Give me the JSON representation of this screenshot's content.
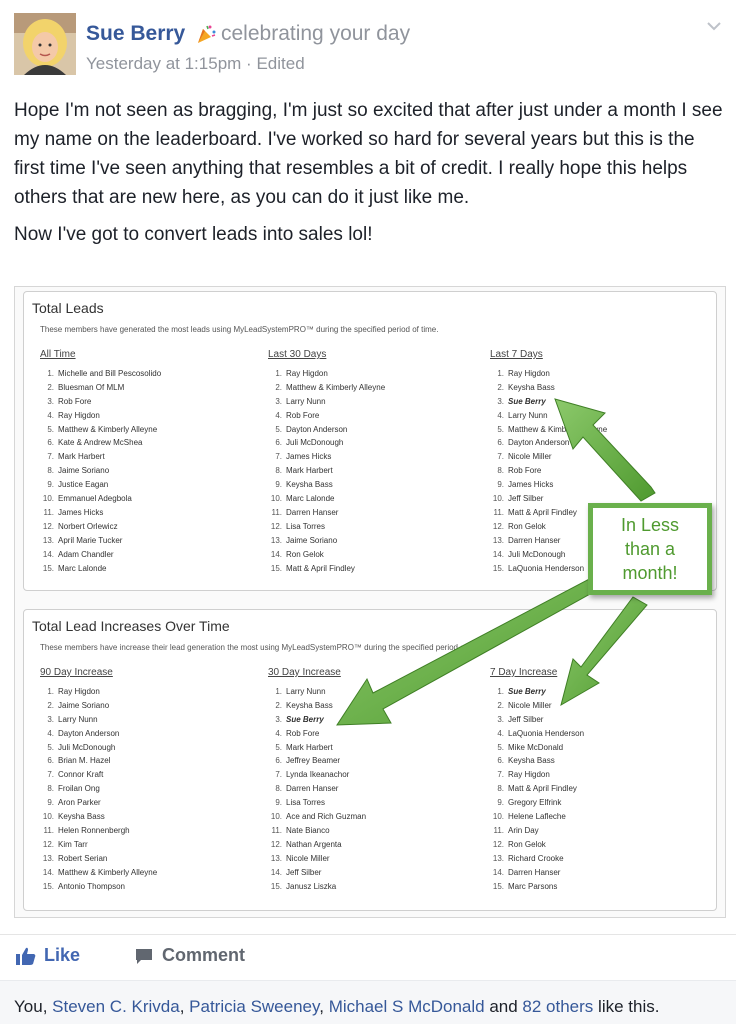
{
  "post": {
    "author": "Sue Berry",
    "activity": "celebrating your day",
    "timestamp": "Yesterday at 1:15pm",
    "separator": "·",
    "edited": "Edited",
    "paragraphs": [
      "Hope I'm not seen as bragging, I'm just so excited that after just under a month I see my name on the leaderboard. I've worked so hard for several years but this is the first time I've seen anything that resembles a bit of credit. I really hope this helps others that are new here, as you can do it just like me.",
      "Now I've got to convert leads into sales lol!"
    ]
  },
  "leaderboard": {
    "total_leads": {
      "title": "Total Leads",
      "description": "These members have generated the most leads using MyLeadSystemPRO™ during the specified period of time.",
      "columns": [
        {
          "heading": "All Time",
          "names": [
            "Michelle and Bill Pescosolido",
            "Bluesman Of MLM",
            "Rob Fore",
            "Ray Higdon",
            "Matthew & Kimberly Alleyne",
            "Kate & Andrew McShea",
            "Mark Harbert",
            "Jaime Soriano",
            "Justice Eagan",
            "Emmanuel Adegbola",
            "James Hicks",
            "Norbert Orlewicz",
            "April Marie Tucker",
            "Adam Chandler",
            "Marc Lalonde"
          ]
        },
        {
          "heading": "Last 30 Days",
          "names": [
            "Ray Higdon",
            "Matthew & Kimberly Alleyne",
            "Larry Nunn",
            "Rob Fore",
            "Dayton Anderson",
            "Juli McDonough",
            "James Hicks",
            "Mark Harbert",
            "Keysha Bass",
            "Marc Lalonde",
            "Darren Hanser",
            "Lisa Torres",
            "Jaime Soriano",
            "Ron Gelok",
            "Matt & April Findley"
          ]
        },
        {
          "heading": "Last 7 Days",
          "names": [
            "Ray Higdon",
            "Keysha Bass",
            "Sue Berry",
            "Larry Nunn",
            "Matthew & Kimberly Alleyne",
            "Dayton Anderson",
            "Nicole Miller",
            "Rob Fore",
            "James Hicks",
            "Jeff Silber",
            "Matt & April Findley",
            "Ron Gelok",
            "Darren Hanser",
            "Juli McDonough",
            "LaQuonia Henderson"
          ]
        }
      ]
    },
    "lead_increases": {
      "title": "Total Lead Increases Over Time",
      "description": "These members have increase their lead generation the most using MyLeadSystemPRO™ during the specified period of time.",
      "columns": [
        {
          "heading": "90 Day Increase",
          "names": [
            "Ray Higdon",
            "Jaime Soriano",
            "Larry Nunn",
            "Dayton Anderson",
            "Juli McDonough",
            "Brian M. Hazel",
            "Connor Kraft",
            "Froilan Ong",
            "Aron Parker",
            "Keysha Bass",
            "Helen Ronnenbergh",
            "Kim Tarr",
            "Robert Serian",
            "Matthew & Kimberly Alleyne",
            "Antonio Thompson"
          ]
        },
        {
          "heading": "30 Day Increase",
          "names": [
            "Larry Nunn",
            "Keysha Bass",
            "Sue Berry",
            "Rob Fore",
            "Mark Harbert",
            "Jeffrey Beamer",
            "Lynda Ikeanachor",
            "Darren Hanser",
            "Lisa Torres",
            "Ace and Rich Guzman",
            "Nate Bianco",
            "Nathan Argenta",
            "Nicole Miller",
            "Jeff Silber",
            "Janusz Liszka"
          ]
        },
        {
          "heading": "7 Day Increase",
          "names": [
            "Sue Berry",
            "Nicole Miller",
            "Jeff Silber",
            "LaQuonia Henderson",
            "Mike McDonald",
            "Keysha Bass",
            "Ray Higdon",
            "Matt & April Findley",
            "Gregory Elfrink",
            "Helene Lafleche",
            "Arin Day",
            "Ron Gelok",
            "Richard Crooke",
            "Darren Hanser",
            "Marc Parsons"
          ]
        }
      ]
    },
    "callout": [
      "In Less",
      "than a",
      "month!"
    ],
    "callout_color": "#6ab04c"
  },
  "actions": {
    "like": "Like",
    "comment": "Comment"
  },
  "likes": {
    "prefix": "You, ",
    "names": [
      "Steven C. Krivda",
      "Patricia Sweeney",
      "Michael S McDonald"
    ],
    "and": " and ",
    "others": "82 others",
    "suffix": " like this."
  },
  "colors": {
    "link": "#365899",
    "muted": "#90949c",
    "arrow_green": "#6ab04c"
  }
}
